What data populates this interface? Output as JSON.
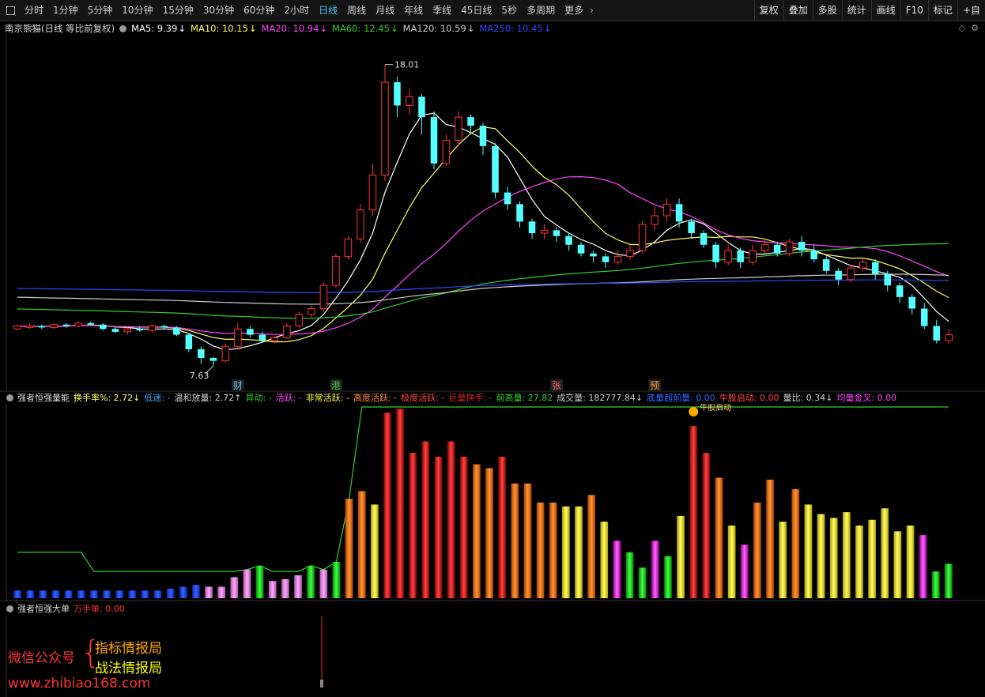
{
  "toolbar": {
    "periods": [
      "分时",
      "1分钟",
      "5分钟",
      "10分钟",
      "15分钟",
      "30分钟",
      "60分钟",
      "2小时",
      "日线",
      "周线",
      "月线",
      "年线",
      "季线",
      "45日线",
      "5秒",
      "多周期",
      "更多"
    ],
    "active_period": "日线",
    "right_buttons": [
      "复权",
      "叠加",
      "多股",
      "统计",
      "画线",
      "F10",
      "标记",
      "+自"
    ]
  },
  "main_header": {
    "title": "南京熊猫(日线 等比前复权)",
    "ma": [
      {
        "label": "MA5: 9.39",
        "arrow": "↓",
        "color": "#ffffff"
      },
      {
        "label": "MA10: 10.15",
        "arrow": "↓",
        "color": "#ffff66"
      },
      {
        "label": "MA20: 10.94",
        "arrow": "↓",
        "color": "#ff44ff"
      },
      {
        "label": "MA60: 12.45",
        "arrow": "↓",
        "color": "#33cc33"
      },
      {
        "label": "MA120: 10.59",
        "arrow": "↓",
        "color": "#cccccc"
      },
      {
        "label": "MA250: 10.45",
        "arrow": "↓",
        "color": "#3344ff"
      }
    ],
    "icons": [
      "diamond-icon",
      "settings-icon"
    ]
  },
  "price_annotations": {
    "high": "18.01",
    "low": "7.63"
  },
  "event_markers": [
    {
      "text": "财",
      "color": "#4fc3f7",
      "x_index": 18
    },
    {
      "text": "港",
      "color": "#33cc33",
      "x_index": 26
    },
    {
      "text": "张",
      "color": "#ff6666",
      "x_index": 44
    },
    {
      "text": "预",
      "color": "#ff9933",
      "x_index": 52
    }
  ],
  "indicator1": {
    "name": "强者恒强量能",
    "fields": [
      {
        "label": "换手率%: 2.72",
        "arrow": "↓",
        "color": "#ffff66"
      },
      {
        "label": "低迷: -",
        "color": "#4f9fff"
      },
      {
        "label": "温和放量: 2.72",
        "arrow": "↑",
        "color": "#cccccc"
      },
      {
        "label": "异动: -",
        "color": "#33cc33"
      },
      {
        "label": "活跃: -",
        "color": "#ff44ff"
      },
      {
        "label": "非常活跃: -",
        "color": "#ffff44"
      },
      {
        "label": "高度活跃: -",
        "color": "#ff8844"
      },
      {
        "label": "极度活跃: -",
        "color": "#ff4444"
      },
      {
        "label": "巨量换手: -",
        "color": "#cc2222"
      },
      {
        "label": "前高量: 27.82",
        "color": "#33cc33"
      },
      {
        "label": "成交量: 182777.84",
        "arrow": "↓",
        "color": "#cccccc"
      },
      {
        "label": "底量超前量: 0.00",
        "color": "#3366ff"
      },
      {
        "label": "牛股启动: 0.00",
        "color": "#ff4444"
      },
      {
        "label": "量比: 0.34",
        "arrow": "↓",
        "color": "#cccccc"
      },
      {
        "label": "均量金叉: 0.00",
        "color": "#ff44ff"
      }
    ],
    "marker_text": "牛股启动"
  },
  "indicator2": {
    "name": "强者恒强大单",
    "fields": [
      {
        "label": "万手单: 0.00",
        "color": "#ff3333"
      }
    ]
  },
  "watermark": {
    "left": "微信公众号",
    "brace": "{",
    "line1": "指标情报局",
    "line2": "战法情报局",
    "url": "www.zhibiao168.com"
  },
  "chart_data": {
    "type": "candlestick",
    "candles": [
      [
        8.9,
        9.0,
        8.85,
        9.05
      ],
      [
        8.95,
        9.0,
        8.9,
        9.1
      ],
      [
        9.0,
        8.95,
        8.9,
        9.05
      ],
      [
        8.95,
        9.05,
        8.9,
        9.1
      ],
      [
        9.05,
        9.0,
        8.95,
        9.1
      ],
      [
        9.0,
        9.1,
        8.95,
        9.15
      ],
      [
        9.1,
        9.05,
        9.0,
        9.15
      ],
      [
        9.05,
        8.9,
        8.85,
        9.1
      ],
      [
        8.9,
        8.8,
        8.75,
        8.95
      ],
      [
        8.8,
        8.9,
        8.7,
        8.95
      ],
      [
        8.9,
        8.85,
        8.8,
        9.0
      ],
      [
        8.85,
        9.0,
        8.8,
        9.05
      ],
      [
        9.0,
        8.95,
        8.9,
        9.05
      ],
      [
        8.95,
        8.7,
        8.65,
        9.0
      ],
      [
        8.7,
        8.2,
        8.1,
        8.75
      ],
      [
        8.2,
        7.9,
        7.7,
        8.3
      ],
      [
        7.9,
        7.8,
        7.63,
        7.95
      ],
      [
        7.8,
        8.3,
        7.75,
        8.4
      ],
      [
        8.3,
        8.9,
        8.2,
        9.1
      ],
      [
        8.9,
        8.7,
        8.6,
        9.0
      ],
      [
        8.7,
        8.5,
        8.45,
        8.8
      ],
      [
        8.5,
        8.6,
        8.4,
        8.65
      ],
      [
        8.6,
        9.0,
        8.55,
        9.1
      ],
      [
        9.0,
        9.4,
        8.95,
        9.5
      ],
      [
        9.4,
        9.6,
        9.3,
        9.7
      ],
      [
        9.6,
        10.4,
        9.5,
        10.5
      ],
      [
        10.4,
        11.4,
        10.3,
        11.5
      ],
      [
        11.4,
        12.0,
        11.3,
        12.1
      ],
      [
        12.0,
        13.0,
        11.9,
        13.2
      ],
      [
        13.0,
        14.2,
        12.8,
        14.6
      ],
      [
        14.2,
        17.4,
        14.0,
        18.01
      ],
      [
        17.4,
        16.6,
        16.2,
        17.6
      ],
      [
        16.6,
        16.9,
        16.3,
        17.2
      ],
      [
        16.9,
        16.2,
        15.6,
        17.0
      ],
      [
        16.2,
        14.6,
        14.4,
        16.4
      ],
      [
        14.6,
        15.4,
        14.5,
        15.6
      ],
      [
        15.4,
        16.2,
        15.2,
        16.4
      ],
      [
        16.2,
        15.9,
        15.6,
        16.3
      ],
      [
        15.9,
        15.2,
        14.9,
        16.0
      ],
      [
        15.2,
        13.6,
        13.4,
        15.3
      ],
      [
        13.6,
        13.2,
        13.0,
        13.8
      ],
      [
        13.2,
        12.6,
        12.4,
        13.3
      ],
      [
        12.6,
        12.2,
        12.0,
        12.7
      ],
      [
        12.2,
        12.3,
        12.0,
        12.5
      ],
      [
        12.3,
        12.1,
        11.9,
        12.4
      ],
      [
        12.1,
        11.8,
        11.6,
        12.2
      ],
      [
        11.8,
        11.5,
        11.4,
        11.9
      ],
      [
        11.5,
        11.4,
        11.2,
        11.6
      ],
      [
        11.4,
        11.2,
        11.0,
        11.5
      ],
      [
        11.2,
        11.4,
        11.1,
        11.6
      ],
      [
        11.4,
        11.6,
        11.3,
        11.8
      ],
      [
        11.6,
        12.5,
        11.5,
        12.6
      ],
      [
        12.5,
        12.8,
        12.3,
        13.1
      ],
      [
        12.8,
        13.2,
        12.6,
        13.4
      ],
      [
        13.2,
        12.6,
        12.4,
        13.4
      ],
      [
        12.6,
        12.2,
        12.0,
        12.7
      ],
      [
        12.2,
        11.8,
        11.7,
        12.3
      ],
      [
        11.8,
        11.2,
        11.0,
        11.9
      ],
      [
        11.2,
        11.6,
        11.1,
        11.8
      ],
      [
        11.6,
        11.2,
        11.0,
        11.7
      ],
      [
        11.2,
        11.6,
        11.1,
        11.8
      ],
      [
        11.6,
        11.8,
        11.5,
        12.0
      ],
      [
        11.8,
        11.5,
        11.4,
        11.9
      ],
      [
        11.5,
        11.9,
        11.4,
        12.0
      ],
      [
        11.9,
        11.6,
        11.4,
        12.1
      ],
      [
        11.6,
        11.3,
        11.2,
        11.8
      ],
      [
        11.3,
        10.9,
        10.8,
        11.4
      ],
      [
        10.9,
        10.6,
        10.4,
        11.0
      ],
      [
        10.6,
        11.0,
        10.5,
        11.1
      ],
      [
        11.0,
        11.2,
        10.9,
        11.3
      ],
      [
        11.2,
        10.8,
        10.6,
        11.3
      ],
      [
        10.8,
        10.4,
        10.2,
        10.9
      ],
      [
        10.4,
        10.0,
        9.8,
        10.5
      ],
      [
        10.0,
        9.6,
        9.4,
        10.1
      ],
      [
        9.6,
        9.0,
        8.9,
        9.8
      ],
      [
        9.0,
        8.5,
        8.4,
        9.2
      ],
      [
        8.5,
        8.7,
        8.4,
        8.9
      ]
    ],
    "ma_lines": {
      "MA5": {
        "color": "#ffffff"
      },
      "MA10": {
        "color": "#ffff66"
      },
      "MA20": {
        "color": "#ff44ff"
      },
      "MA60": {
        "color": "#33cc33"
      },
      "MA120": {
        "color": "#cccccc"
      },
      "MA250": {
        "color": "#3344ff"
      }
    },
    "volume": [
      0.4,
      0.4,
      0.4,
      0.4,
      0.4,
      0.4,
      0.4,
      0.4,
      0.4,
      0.4,
      0.4,
      0.4,
      0.5,
      0.6,
      0.7,
      0.6,
      0.6,
      1.1,
      1.5,
      1.7,
      0.9,
      1.0,
      1.2,
      1.7,
      1.5,
      1.9,
      5.2,
      5.6,
      4.9,
      9.7,
      9.9,
      7.6,
      8.2,
      7.4,
      8.2,
      7.4,
      7.0,
      6.8,
      7.4,
      6.0,
      6.0,
      5.0,
      5.0,
      4.8,
      4.8,
      5.4,
      4.0,
      3.0,
      2.4,
      1.6,
      3.0,
      2.2,
      4.3,
      9.0,
      7.6,
      6.3,
      3.8,
      2.8,
      5.0,
      6.2,
      4.0,
      5.7,
      4.9,
      4.4,
      4.2,
      4.5,
      3.8,
      4.1,
      4.7,
      3.5,
      3.8,
      3.3,
      1.4,
      1.8
    ]
  }
}
